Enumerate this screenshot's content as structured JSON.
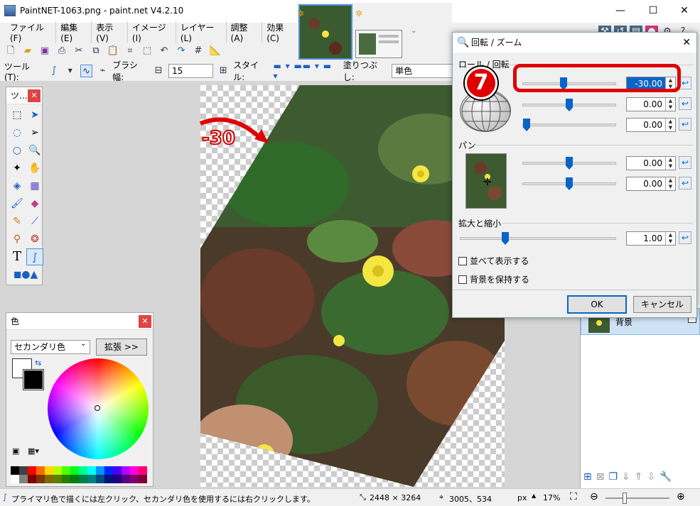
{
  "window": {
    "title": "PaintNET-1063.png - paint.net V4.2.10",
    "minimize": "—",
    "maximize": "☐",
    "close": "✕"
  },
  "menu": [
    "ファイル(F)",
    "編集(E)",
    "表示(V)",
    "イメージ(I)",
    "レイヤー(L)",
    "調整(A)",
    "効果(C)"
  ],
  "toolbar2": {
    "tool_label": "ツール(T):",
    "brush_width_label": "ブラシ幅:",
    "brush_width_value": "15",
    "style_label": "スタイル:",
    "fill_label": "塗りつぶし:",
    "fill_value": "単色"
  },
  "tools_window": {
    "title": "ツ..."
  },
  "color_window": {
    "title": "色",
    "selector_value": "セカンダリ色",
    "expand_button": "拡張 >>",
    "palette": [
      "#000000",
      "#404040",
      "#ff0000",
      "#ff6a00",
      "#ffd800",
      "#b6ff00",
      "#4cff00",
      "#00ff21",
      "#00ff90",
      "#00ffff",
      "#0094ff",
      "#0026ff",
      "#4800ff",
      "#b200ff",
      "#ff00dc",
      "#ff006e",
      "#ffffff",
      "#808080",
      "#7f0000",
      "#7f3300",
      "#7f6a00",
      "#5b7f00",
      "#267f00",
      "#007f0e",
      "#007f46",
      "#007f7f",
      "#004a7f",
      "#00137f",
      "#21007f",
      "#57007f",
      "#7f006e",
      "#7f0037"
    ]
  },
  "dialog": {
    "title": "回転 / ズーム",
    "roll_section": "ロール / 回転",
    "pan_section": "パン",
    "zoom_section": "拡大と縮小",
    "values": {
      "angle": "-30.00",
      "roll": "0.00",
      "roll2": "0.00",
      "pan_x": "0.00",
      "pan_y": "0.00",
      "zoom": "1.00"
    },
    "tile_checkbox": "並べて表示する",
    "keep_bg_checkbox": "背景を保持する",
    "ok": "OK",
    "cancel": "キャンセル"
  },
  "layers": {
    "layer_name": "背景"
  },
  "annotations": {
    "step": "7",
    "angle_note": "-30"
  },
  "status": {
    "hint": "プライマリ色で描くには左クリック、セカンダリ色を使用するには右クリックします。",
    "image_size": "2448 × 3264",
    "cursor_pos": "3005、534",
    "unit": "px",
    "zoom": "17%"
  }
}
